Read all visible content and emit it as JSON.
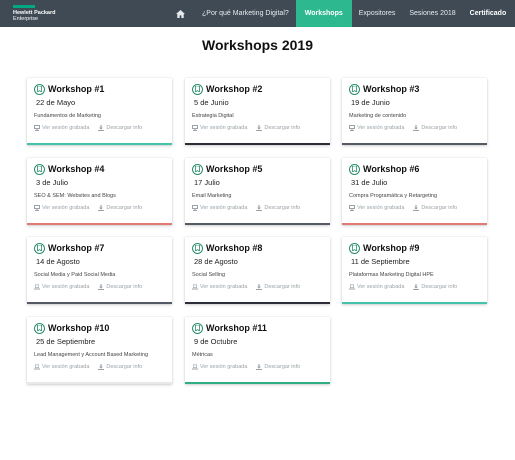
{
  "header": {
    "logo_line1": "Hewlett Packard",
    "logo_line2": "Enterprise",
    "nav": [
      {
        "label": "¿Por qué Marketing Digital?"
      },
      {
        "label": "Workshops"
      },
      {
        "label": "Expositores"
      },
      {
        "label": "Sesiones 2018"
      },
      {
        "label": "Certificado"
      }
    ]
  },
  "page_title": "Workshops 2019",
  "action_labels": {
    "video": "Ver sesión grabada",
    "download": "Descargar info"
  },
  "colors": {
    "accent": "#2eb88f",
    "navbar": "#3f4a54"
  },
  "workshops": [
    {
      "title": "Workshop #1",
      "date": "22 de Mayo",
      "topic": "Fundamentos de Marketing",
      "accent": "#45c2ac",
      "video_icon": "presentation-icon"
    },
    {
      "title": "Workshop #2",
      "date": "5 de Junio",
      "topic": "Estrategia Digital",
      "accent": "#2c2f3a",
      "video_icon": "presentation-icon"
    },
    {
      "title": "Workshop #3",
      "date": "19 de Junio",
      "topic": "Marketing de contenido",
      "accent": "#555b66",
      "video_icon": "presentation-icon"
    },
    {
      "title": "Workshop #4",
      "date": "3 de Julio",
      "topic": "SEO & SEM: Websites and Blogs",
      "accent": "#e07a72",
      "video_icon": "presentation-icon"
    },
    {
      "title": "Workshop #5",
      "date": "17 Julio",
      "topic": "Email Marketing",
      "accent": "#555b66",
      "video_icon": "presentation-icon"
    },
    {
      "title": "Workshop #6",
      "date": "31 de Julio",
      "topic": "Compra Programática y Retargeting",
      "accent": "#e07a72",
      "video_icon": "presentation-icon"
    },
    {
      "title": "Workshop #7",
      "date": "14 de Agosto",
      "topic": "Social Media y Paid Social Media",
      "accent": "#555b66",
      "video_icon": "laptop-icon"
    },
    {
      "title": "Workshop #8",
      "date": "28 de Agosto",
      "topic": "Social Selling",
      "accent": "#2c2f3a",
      "video_icon": "laptop-icon"
    },
    {
      "title": "Workshop #9",
      "date": "11 de Septiembre",
      "topic": "Plataformas Marketing Digital HPE",
      "accent": "#45c2ac",
      "video_icon": "laptop-icon"
    },
    {
      "title": "Workshop #10",
      "date": "25 de Septiembre",
      "topic": "Lead Management y Account Based Marketing",
      "accent": "#e8e8e8",
      "video_icon": "laptop-icon"
    },
    {
      "title": "Workshop #11",
      "date": "9 de Octubre",
      "topic": "Métricas",
      "accent": "#2fae83",
      "video_icon": "laptop-icon"
    }
  ]
}
